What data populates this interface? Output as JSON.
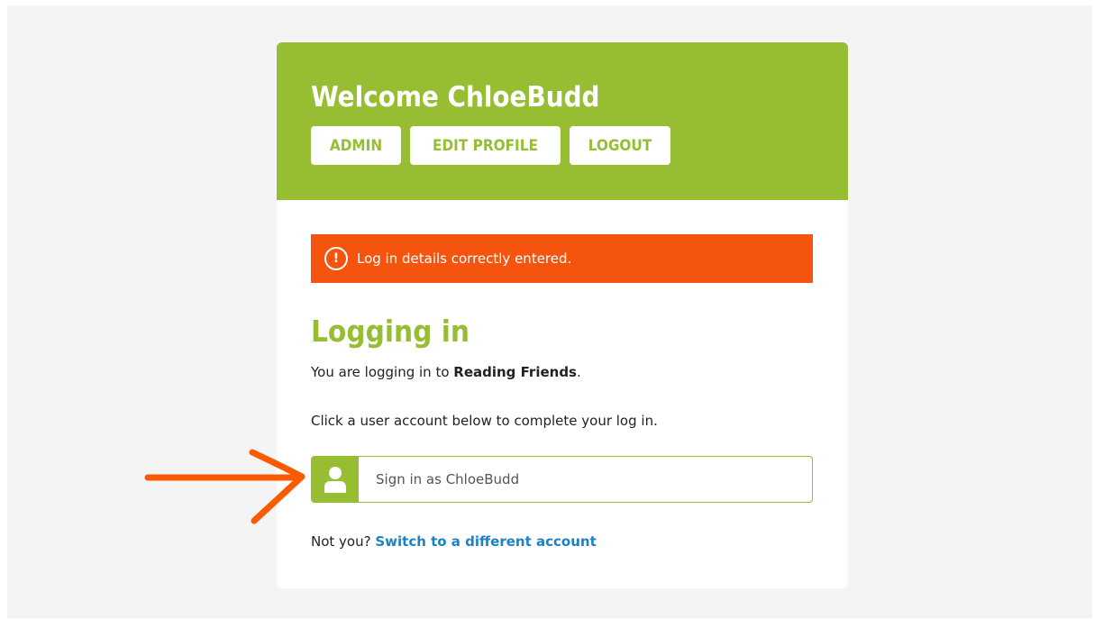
{
  "header": {
    "welcome": "Welcome ChloeBudd",
    "buttons": {
      "admin": "ADMIN",
      "edit_profile": "EDIT PROFILE",
      "logout": "LOGOUT"
    }
  },
  "alert": {
    "icon_glyph": "!",
    "message": "Log in details correctly entered."
  },
  "main": {
    "heading": "Logging in",
    "intro_prefix": "You are logging in to ",
    "intro_app": "Reading Friends",
    "intro_suffix": ".",
    "instruction": "Click a user account below to complete your log in.",
    "signin_label": "Sign in as ChloeBudd",
    "not_you": "Not you? ",
    "switch_link": "Switch to a different account"
  },
  "icons": {
    "alert": "exclamation-circle-icon",
    "user": "user-icon",
    "annotation": "arrow-right-annotation"
  },
  "colors": {
    "brand_green": "#97bd33",
    "alert_orange": "#f5540f",
    "link_blue": "#1c82c4",
    "page_bg": "#f4f4f4",
    "annotation_orange": "#fb5a00"
  }
}
